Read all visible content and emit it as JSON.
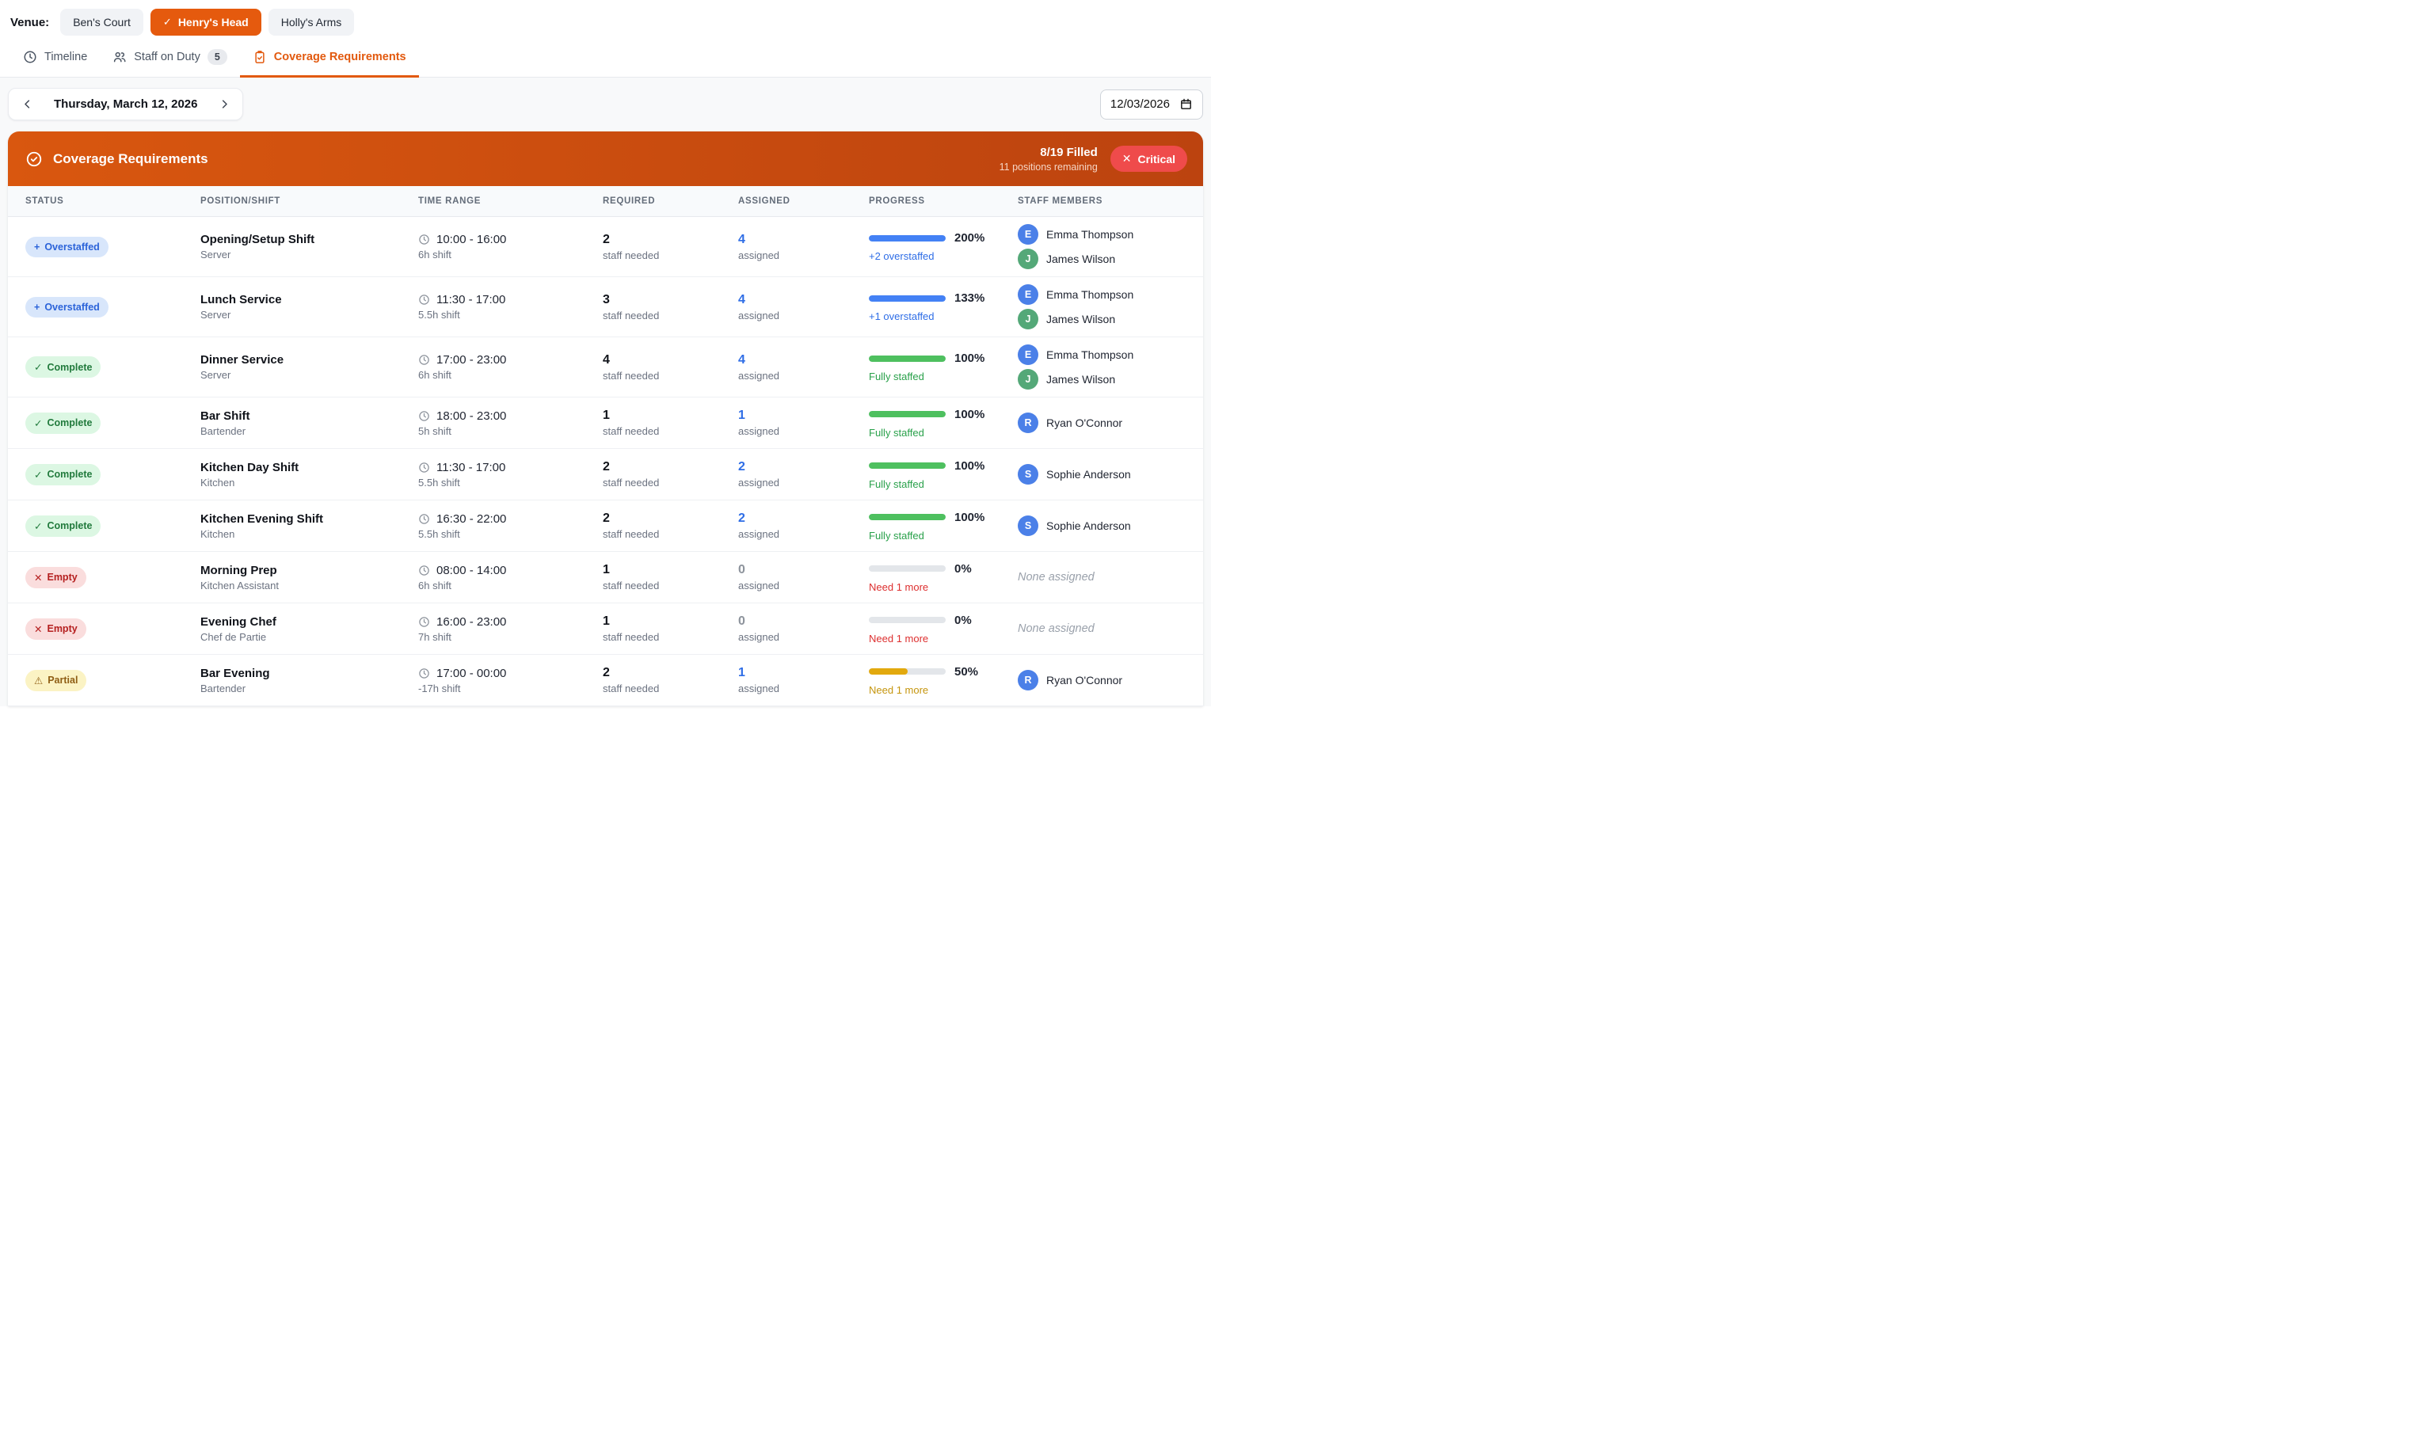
{
  "colors": {
    "accent_orange": "#e55a0e",
    "banner_gradient_start": "#d9570f",
    "banner_gradient_end": "#bc430f",
    "critical_red": "#ef4b4b",
    "bar_blue": "#4381f5",
    "bar_green": "#4ec05f",
    "bar_amber": "#e2a90e",
    "avatar_blue": "#4b80e8",
    "avatar_green": "#54a878"
  },
  "venue_bar": {
    "label": "Venue:",
    "venues": [
      {
        "name": "Ben's Court",
        "selected": false
      },
      {
        "name": "Henry's Head",
        "selected": true,
        "check": "✓"
      },
      {
        "name": "Holly's Arms",
        "selected": false
      }
    ]
  },
  "tabs": [
    {
      "label": "Timeline",
      "icon": "clock-icon",
      "active": false
    },
    {
      "label": "Staff on Duty",
      "icon": "people-icon",
      "badge": "5",
      "active": false
    },
    {
      "label": "Coverage Requirements",
      "icon": "clipboard-check-icon",
      "active": true
    }
  ],
  "date_nav": {
    "label": "Thursday, March 12, 2026",
    "date_input_value": "12/03/2026"
  },
  "summary": {
    "title": "Coverage Requirements",
    "filled": "8/19 Filled",
    "remaining": "11 positions remaining",
    "severity_icon": "✕",
    "severity": "Critical"
  },
  "table": {
    "columns": [
      "STATUS",
      "POSITION/SHIFT",
      "TIME RANGE",
      "REQUIRED",
      "ASSIGNED",
      "PROGRESS",
      "STAFF MEMBERS"
    ],
    "required_sub": "staff needed",
    "assigned_sub": "assigned",
    "rows": [
      {
        "status": {
          "type": "overstaffed",
          "icon": "+",
          "label": "Overstaffed"
        },
        "position": "Opening/Setup Shift",
        "role": "Server",
        "time": "10:00 - 16:00",
        "duration": "6h shift",
        "required": "2",
        "assigned": "4",
        "progress": {
          "percent": "200%",
          "fill_pct": 100,
          "color": "blue",
          "label": "+2 overstaffed"
        },
        "staff": [
          {
            "initial": "E",
            "name": "Emma Thompson",
            "color": "blue"
          },
          {
            "initial": "J",
            "name": "James Wilson",
            "color": "green"
          }
        ]
      },
      {
        "status": {
          "type": "overstaffed",
          "icon": "+",
          "label": "Overstaffed"
        },
        "position": "Lunch Service",
        "role": "Server",
        "time": "11:30 - 17:00",
        "duration": "5.5h shift",
        "required": "3",
        "assigned": "4",
        "progress": {
          "percent": "133%",
          "fill_pct": 100,
          "color": "blue",
          "label": "+1 overstaffed"
        },
        "staff": [
          {
            "initial": "E",
            "name": "Emma Thompson",
            "color": "blue"
          },
          {
            "initial": "J",
            "name": "James Wilson",
            "color": "green"
          }
        ]
      },
      {
        "status": {
          "type": "complete",
          "icon": "✓",
          "label": "Complete"
        },
        "position": "Dinner Service",
        "role": "Server",
        "time": "17:00 - 23:00",
        "duration": "6h shift",
        "required": "4",
        "assigned": "4",
        "progress": {
          "percent": "100%",
          "fill_pct": 100,
          "color": "green",
          "label": "Fully staffed"
        },
        "staff": [
          {
            "initial": "E",
            "name": "Emma Thompson",
            "color": "blue"
          },
          {
            "initial": "J",
            "name": "James Wilson",
            "color": "green"
          }
        ]
      },
      {
        "status": {
          "type": "complete",
          "icon": "✓",
          "label": "Complete"
        },
        "position": "Bar Shift",
        "role": "Bartender",
        "time": "18:00 - 23:00",
        "duration": "5h shift",
        "required": "1",
        "assigned": "1",
        "progress": {
          "percent": "100%",
          "fill_pct": 100,
          "color": "green",
          "label": "Fully staffed"
        },
        "staff": [
          {
            "initial": "R",
            "name": "Ryan O'Connor",
            "color": "blue"
          }
        ]
      },
      {
        "status": {
          "type": "complete",
          "icon": "✓",
          "label": "Complete"
        },
        "position": "Kitchen Day Shift",
        "role": "Kitchen",
        "time": "11:30 - 17:00",
        "duration": "5.5h shift",
        "required": "2",
        "assigned": "2",
        "progress": {
          "percent": "100%",
          "fill_pct": 100,
          "color": "green",
          "label": "Fully staffed"
        },
        "staff": [
          {
            "initial": "S",
            "name": "Sophie Anderson",
            "color": "blue"
          }
        ]
      },
      {
        "status": {
          "type": "complete",
          "icon": "✓",
          "label": "Complete"
        },
        "position": "Kitchen Evening Shift",
        "role": "Kitchen",
        "time": "16:30 - 22:00",
        "duration": "5.5h shift",
        "required": "2",
        "assigned": "2",
        "progress": {
          "percent": "100%",
          "fill_pct": 100,
          "color": "green",
          "label": "Fully staffed"
        },
        "staff": [
          {
            "initial": "S",
            "name": "Sophie Anderson",
            "color": "blue"
          }
        ]
      },
      {
        "status": {
          "type": "empty",
          "icon": "✕",
          "label": "Empty"
        },
        "position": "Morning Prep",
        "role": "Kitchen Assistant",
        "time": "08:00 - 14:00",
        "duration": "6h shift",
        "required": "1",
        "assigned": "0",
        "progress": {
          "percent": "0%",
          "fill_pct": 0,
          "color": "red",
          "label": "Need 1 more"
        },
        "staff": [],
        "none_label": "None assigned"
      },
      {
        "status": {
          "type": "empty",
          "icon": "✕",
          "label": "Empty"
        },
        "position": "Evening Chef",
        "role": "Chef de Partie",
        "time": "16:00 - 23:00",
        "duration": "7h shift",
        "required": "1",
        "assigned": "0",
        "progress": {
          "percent": "0%",
          "fill_pct": 0,
          "color": "red",
          "label": "Need 1 more"
        },
        "staff": [],
        "none_label": "None assigned"
      },
      {
        "status": {
          "type": "partial",
          "icon": "⚠",
          "label": "Partial"
        },
        "position": "Bar Evening",
        "role": "Bartender",
        "time": "17:00 - 00:00",
        "duration": "-17h shift",
        "required": "2",
        "assigned": "1",
        "progress": {
          "percent": "50%",
          "fill_pct": 50,
          "color": "amber",
          "label": "Need 1 more"
        },
        "staff": [
          {
            "initial": "R",
            "name": "Ryan O'Connor",
            "color": "blue"
          }
        ]
      }
    ]
  }
}
